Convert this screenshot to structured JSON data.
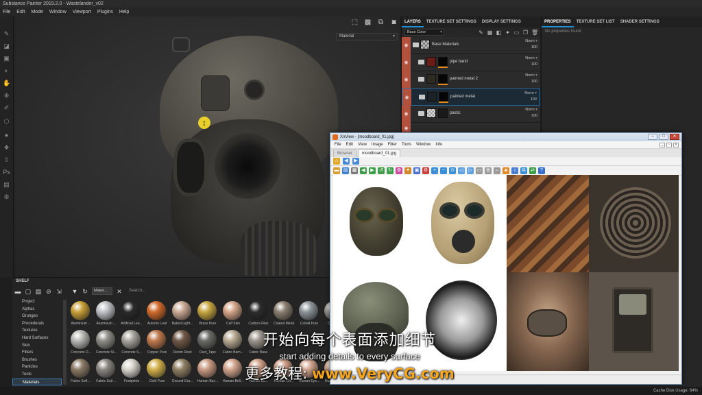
{
  "window": {
    "title": "Substance Painter 2019.2.0 - Wastelander_v02"
  },
  "menu": [
    "File",
    "Edit",
    "Mode",
    "Window",
    "Viewport",
    "Plugins",
    "Help"
  ],
  "viewport": {
    "mode": "Material"
  },
  "layers_panel": {
    "tabs": [
      "LAYERS",
      "TEXTURE SET SETTINGS",
      "DISPLAY SETTINGS"
    ],
    "channel": "Base Color",
    "layers": [
      {
        "name": "Base Materials",
        "blend": "Norm",
        "opacity": "100"
      },
      {
        "name": "pipe band",
        "blend": "Norm",
        "opacity": "100"
      },
      {
        "name": "painted metal 2",
        "blend": "Norm",
        "opacity": "100"
      },
      {
        "name": "painted metal",
        "blend": "Norm",
        "opacity": "100"
      },
      {
        "name": "pastic",
        "blend": "Norm",
        "opacity": "100"
      }
    ]
  },
  "properties_panel": {
    "tabs": [
      "PROPERTIES",
      "TEXTURE SET LIST",
      "SHADER SETTINGS"
    ],
    "empty_text": "No properties found"
  },
  "shelf": {
    "title": "SHELF",
    "filter_chip": "Materi...",
    "search_placeholder": "Search...",
    "categories": [
      "Project",
      "Alphas",
      "Grunges",
      "Procedurals",
      "Textures",
      "Hard Surfaces",
      "Skin",
      "Filters",
      "Brushes",
      "Particles",
      "Tools",
      "Materials"
    ],
    "active_category": "Materials",
    "materials": [
      [
        "Aluminium ...",
        "Aluminium ...",
        "Artificial Lea...",
        "Autumn Leaf",
        "Baked Light...",
        "Brass Pure",
        "Calf Skin",
        "Carbon Fiber",
        "Coated Metal",
        "Cobalt Pure",
        "Concre..."
      ],
      [
        "Concrete D...",
        "Concrete Sl...",
        "Concrete S...",
        "Copper Pure",
        "Denim Rivet",
        "Duct_Tape",
        "Fabric Barn...",
        "Fabric Base",
        "",
        "",
        ""
      ],
      [
        "Fabric Soft ...",
        "Fabric Suit ...",
        "Footprints",
        "Gold Pure",
        "Ground Gra...",
        "Human Bac...",
        "Human Bell...",
        "Human Bu...",
        "Human Ch...",
        "Human Eye...",
        "Human He..."
      ]
    ],
    "colors": [
      "#c9a03a",
      "#bfc2c6",
      "#2a2a2a",
      "#d06a2c",
      "#c9a893",
      "#c8a642",
      "#d4a589",
      "#2c2c2c",
      "#8a7f70",
      "#8c9499",
      "#9a9792"
    ]
  },
  "xnview": {
    "title": "XnView - [moodboard_01.jpg]",
    "menu": [
      "File",
      "Edit",
      "View",
      "Image",
      "Filter",
      "Tools",
      "Window",
      "Info"
    ],
    "tabs": [
      "Browser",
      "moodboard_01.jpg"
    ]
  },
  "status": {
    "cache": "Cache Disk Usage:",
    "percent": "64%"
  },
  "subtitles": {
    "cn": "开始向每个表面添加细节",
    "en": "start adding details to every surface",
    "site_cn": "更多教程:",
    "site_url": "www.VeryCG.com"
  }
}
